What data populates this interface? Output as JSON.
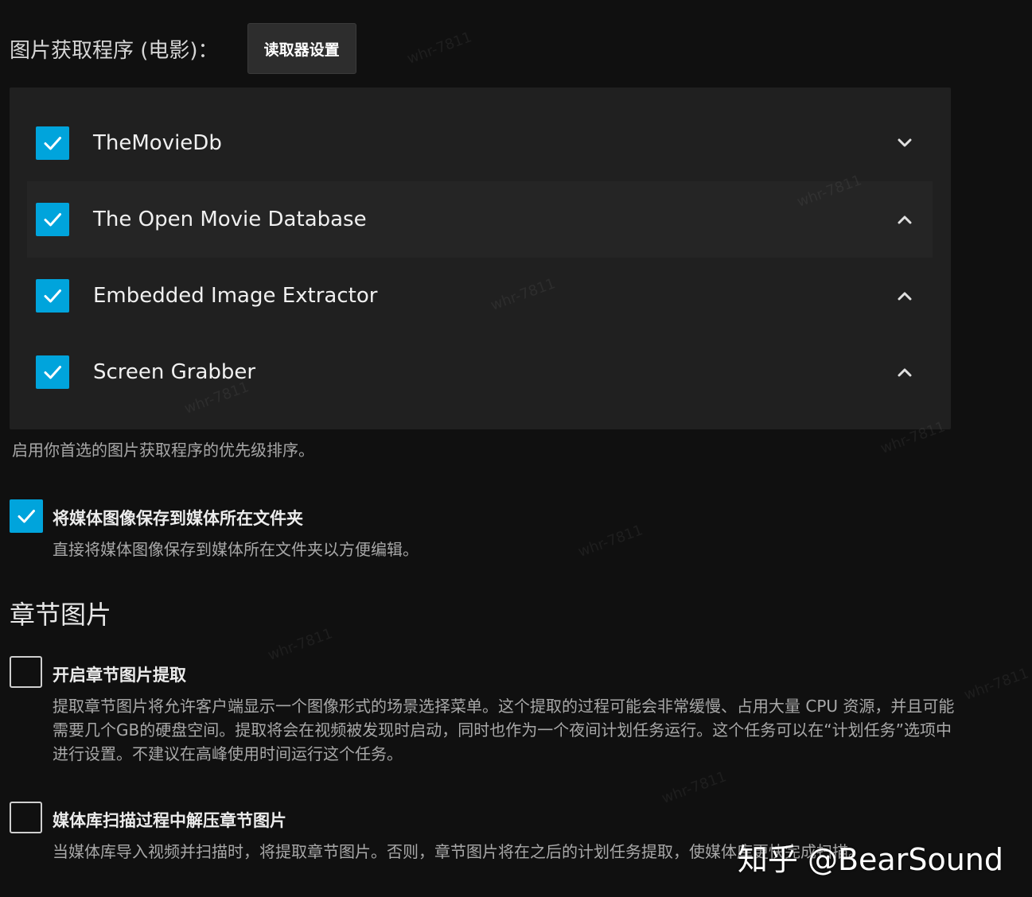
{
  "fetchers": {
    "title": "图片获取程序 (电影)：",
    "settings_button": "读取器设置",
    "items": [
      {
        "label": "TheMovieDb",
        "checked": true,
        "chevron": "chevron-down-icon"
      },
      {
        "label": "The Open Movie Database",
        "checked": true,
        "chevron": "chevron-up-icon"
      },
      {
        "label": "Embedded Image Extractor",
        "checked": true,
        "chevron": "chevron-up-icon"
      },
      {
        "label": "Screen Grabber",
        "checked": true,
        "chevron": "chevron-up-icon"
      }
    ],
    "help": "启用你首选的图片获取程序的优先级排序。"
  },
  "save_local": {
    "label": "将媒体图像保存到媒体所在文件夹",
    "checked": true,
    "description": "直接将媒体图像保存到媒体所在文件夹以方便编辑。"
  },
  "chapters": {
    "title": "章节图片",
    "extract": {
      "label": "开启章节图片提取",
      "checked": false,
      "description": "提取章节图片将允许客户端显示一个图像形式的场景选择菜单。这个提取的过程可能会非常缓慢、占用大量 CPU 资源，并且可能需要几个GB的硬盘空间。提取将会在视频被发现时启动，同时也作为一个夜间计划任务运行。这个任务可以在“计划任务”选项中进行设置。不建议在高峰使用时间运行这个任务。"
    },
    "extract_during_scan": {
      "label": "媒体库扫描过程中解压章节图片",
      "checked": false,
      "description": "当媒体库导入视频并扫描时，将提取章节图片。否则，章节图片将在之后的计划任务提取，使媒体库更快完成扫描。"
    }
  },
  "watermarks": {
    "user_mark": "whr-7811",
    "brand": "知乎 @BearSound"
  },
  "colors": {
    "accent": "#00a4dc",
    "background": "#101010",
    "panel": "#202020"
  }
}
